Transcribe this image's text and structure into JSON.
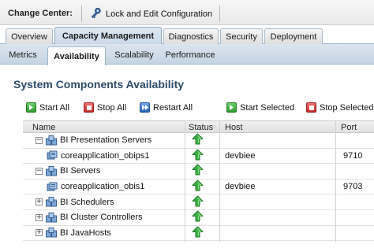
{
  "change_center": {
    "title": "Change Center:",
    "lock_label": "Lock and Edit Configuration"
  },
  "main_tabs": [
    {
      "label": "Overview",
      "active": false
    },
    {
      "label": "Capacity Management",
      "active": true
    },
    {
      "label": "Diagnostics",
      "active": false
    },
    {
      "label": "Security",
      "active": false
    },
    {
      "label": "Deployment",
      "active": false
    }
  ],
  "sub_tabs": [
    {
      "label": "Metrics",
      "active": false
    },
    {
      "label": "Availability",
      "active": true
    },
    {
      "label": "Scalability",
      "active": false
    },
    {
      "label": "Performance",
      "active": false
    }
  ],
  "section": {
    "title": "System Components Availability"
  },
  "toolbar": {
    "start_all": "Start All",
    "stop_all": "Stop All",
    "restart_all": "Restart All",
    "start_selected": "Start Selected",
    "stop_selected": "Stop Selected"
  },
  "table": {
    "columns": {
      "name": "Name",
      "status": "Status",
      "host": "Host",
      "port": "Port"
    },
    "rows": [
      {
        "name": "BI Presentation Servers",
        "expander": "−",
        "host": "",
        "port": ""
      },
      {
        "name": "coreapplication_obips1",
        "expander": "",
        "host": "devbiee",
        "port": "9710"
      },
      {
        "name": "BI Servers",
        "expander": "−",
        "host": "",
        "port": ""
      },
      {
        "name": "coreapplication_obis1",
        "expander": "",
        "host": "devbiee",
        "port": "9703"
      },
      {
        "name": "BI Schedulers",
        "expander": "+",
        "host": "",
        "port": ""
      },
      {
        "name": "BI Cluster Controllers",
        "expander": "+",
        "host": "",
        "port": ""
      },
      {
        "name": "BI JavaHosts",
        "expander": "+",
        "host": "",
        "port": ""
      }
    ]
  },
  "colors": {
    "section_title": "#2d4a6a",
    "status_up": "#3cb043"
  }
}
